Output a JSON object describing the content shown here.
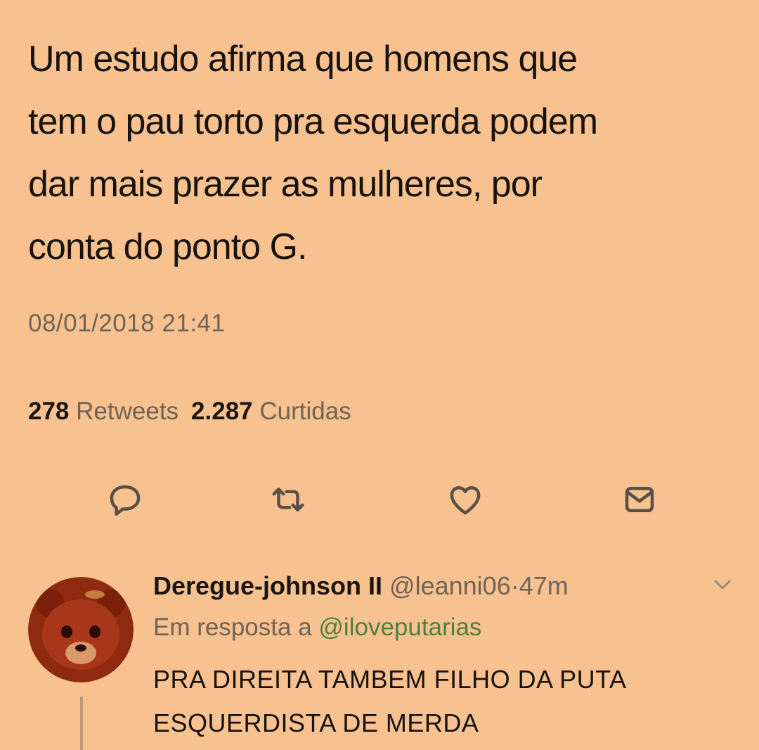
{
  "tweet": {
    "text": "Um estudo afirma que homens que\ntem o pau torto pra esquerda podem\ndar mais prazer as mulheres, por\nconta do ponto G.",
    "timestamp": "08/01/2018 21:41",
    "retweets_count": "278",
    "retweets_label": "Retweets",
    "likes_count": "2.287",
    "likes_label": "Curtidas"
  },
  "actions": {
    "reply_icon": "reply-icon",
    "retweet_icon": "retweet-icon",
    "like_icon": "heart-icon",
    "message_icon": "envelope-icon"
  },
  "reply": {
    "name": "Deregue-johnson II",
    "handle": "@leanni06",
    "separator": "·",
    "time": "47m",
    "in_reply_label": "Em resposta a",
    "in_reply_mention": "@iloveputarias",
    "text": "PRA DIREITA TAMBEM FILHO DA PUTA\nESQUERDISTA DE MERDA"
  },
  "colors": {
    "background": "#f7c28f",
    "text": "#17120d",
    "muted": "#6e6358",
    "mention": "#4e7f3f"
  }
}
